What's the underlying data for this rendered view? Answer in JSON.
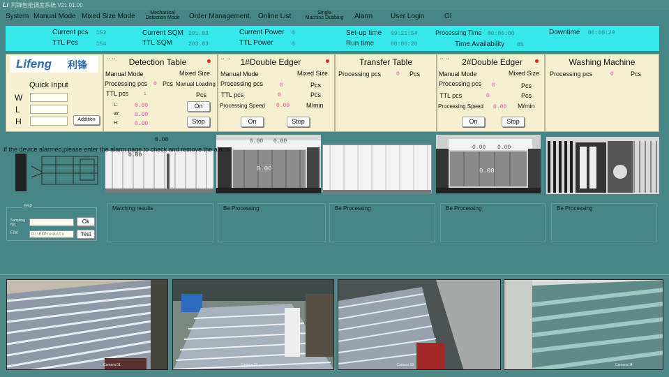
{
  "titlebar": {
    "logo": "Li",
    "text": "利锋智能调度系统 V21.01.00"
  },
  "menu": [
    "System",
    "Manual Mode",
    "Mixed Size Mode",
    "Mechanical",
    "Detection Mode",
    "Order Management.",
    "Online List",
    "Single",
    "Machine Dubbing",
    "Alarm",
    "User Login",
    "OI"
  ],
  "stats": {
    "current_pcs_label": "Current pcs",
    "current_pcs": "152",
    "ttl_pcs_label": "TTL Pcs",
    "ttl_pcs": "154",
    "current_sqm_label": "Current SQM",
    "current_sqm": "201.03",
    "ttl_sqm_label": "TTL SQM",
    "ttl_sqm": "203.03",
    "current_power_label": "Current Power",
    "current_power": "0",
    "ttl_power_label": "TTL Power",
    "ttl_power": "0",
    "setup_time_label": "Set-up time",
    "setup_time": "09:21:54",
    "run_time_label": "Run time",
    "run_time": "00:00:20",
    "processing_time_label": "Processing Time",
    "processing_time": "00:00:00",
    "time_availability_label": "Time Availability",
    "time_availability": "0%",
    "downtime_label": "Downtime",
    "downtime": "00:00:20"
  },
  "quick": {
    "brand": "Lifeng",
    "brand_cn": "利锋",
    "title": "Quick Input",
    "w": "W",
    "l": "L",
    "h": "H",
    "add": "Addition"
  },
  "detection": {
    "dots": "•• ••",
    "title": "Detection Table",
    "manual_mode": "Manual Mode",
    "mixed_size": "Mixed Size",
    "processing_pcs": "Processing pcs",
    "processing_val": "0",
    "pcs": "Pcs",
    "manual_loading": "Manual Loading",
    "ttl_pcs": "TTL pcs",
    "ttl_val": "1",
    "ttl_unit": "Pcs",
    "l_lbl": "L:",
    "l_val": "0.00",
    "w_lbl": "W:",
    "w_val": "0.00",
    "h_lbl": "H:",
    "h_val": "0.00",
    "on": "On",
    "stop": "Stop"
  },
  "edger1": {
    "dots": "•• ••",
    "title": "1#Double Edger",
    "manual_mode": "Manual Mode",
    "mixed_size": "Mixed Size",
    "processing_pcs": "Processing pcs",
    "processing_val": "0",
    "pcs": "Pcs",
    "ttl_pcs": "TTL pcs",
    "ttl_val": "0",
    "ttl_unit": "Pcs",
    "speed": "Processing Speed",
    "speed_val": "0.00",
    "speed_unit": "M/min",
    "on": "On",
    "stop": "Stop"
  },
  "transfer": {
    "title": "Transfer Table",
    "processing_pcs": "Processing pcs",
    "processing_val": "0",
    "pcs": "Pcs"
  },
  "edger2": {
    "dots": "•• ••",
    "title": "2#Double Edger",
    "manual_mode": "Manual Mode",
    "mixed_size": "Mixed Size",
    "processing_pcs": "Processing pcs",
    "processing_val": "0",
    "pcs": "Pcs",
    "ttl_pcs": "TTL pcs",
    "ttl_val": "0",
    "ttl_unit": "Pcs",
    "speed": "Processing Speed",
    "speed_val": "0.00",
    "speed_unit": "M/min",
    "on": "On",
    "stop": "Stop"
  },
  "washing": {
    "title": "Washing Machine",
    "processing_pcs": "Processing pcs",
    "processing_val": "0",
    "pcs": "Pcs"
  },
  "alarm_text": "If the device alarmed,please enter the alarm page to check and remove the alarm",
  "overlays": {
    "det_top": "0.00",
    "det_mid": "0.00",
    "e1_a": "0.00",
    "e1_b": "0.00",
    "e1_big": "0.00",
    "e2_a": "0.00",
    "e2_b": "0.00",
    "e2_big": "0.00"
  },
  "erp": {
    "title": "ERP",
    "sampling": "Sampling No:",
    "ok": "Ok",
    "path_lbl": "F/M",
    "path": "D:\\ERPresults",
    "test": "Test"
  },
  "results": [
    "Matching results",
    "Be Processing",
    "Be Processing",
    "Be Processing",
    "Be Processing"
  ],
  "cameras": {
    "c1": "Camera 01",
    "c2": "Camera 02",
    "c3": "Camera 03",
    "c4": "Camera 04"
  }
}
